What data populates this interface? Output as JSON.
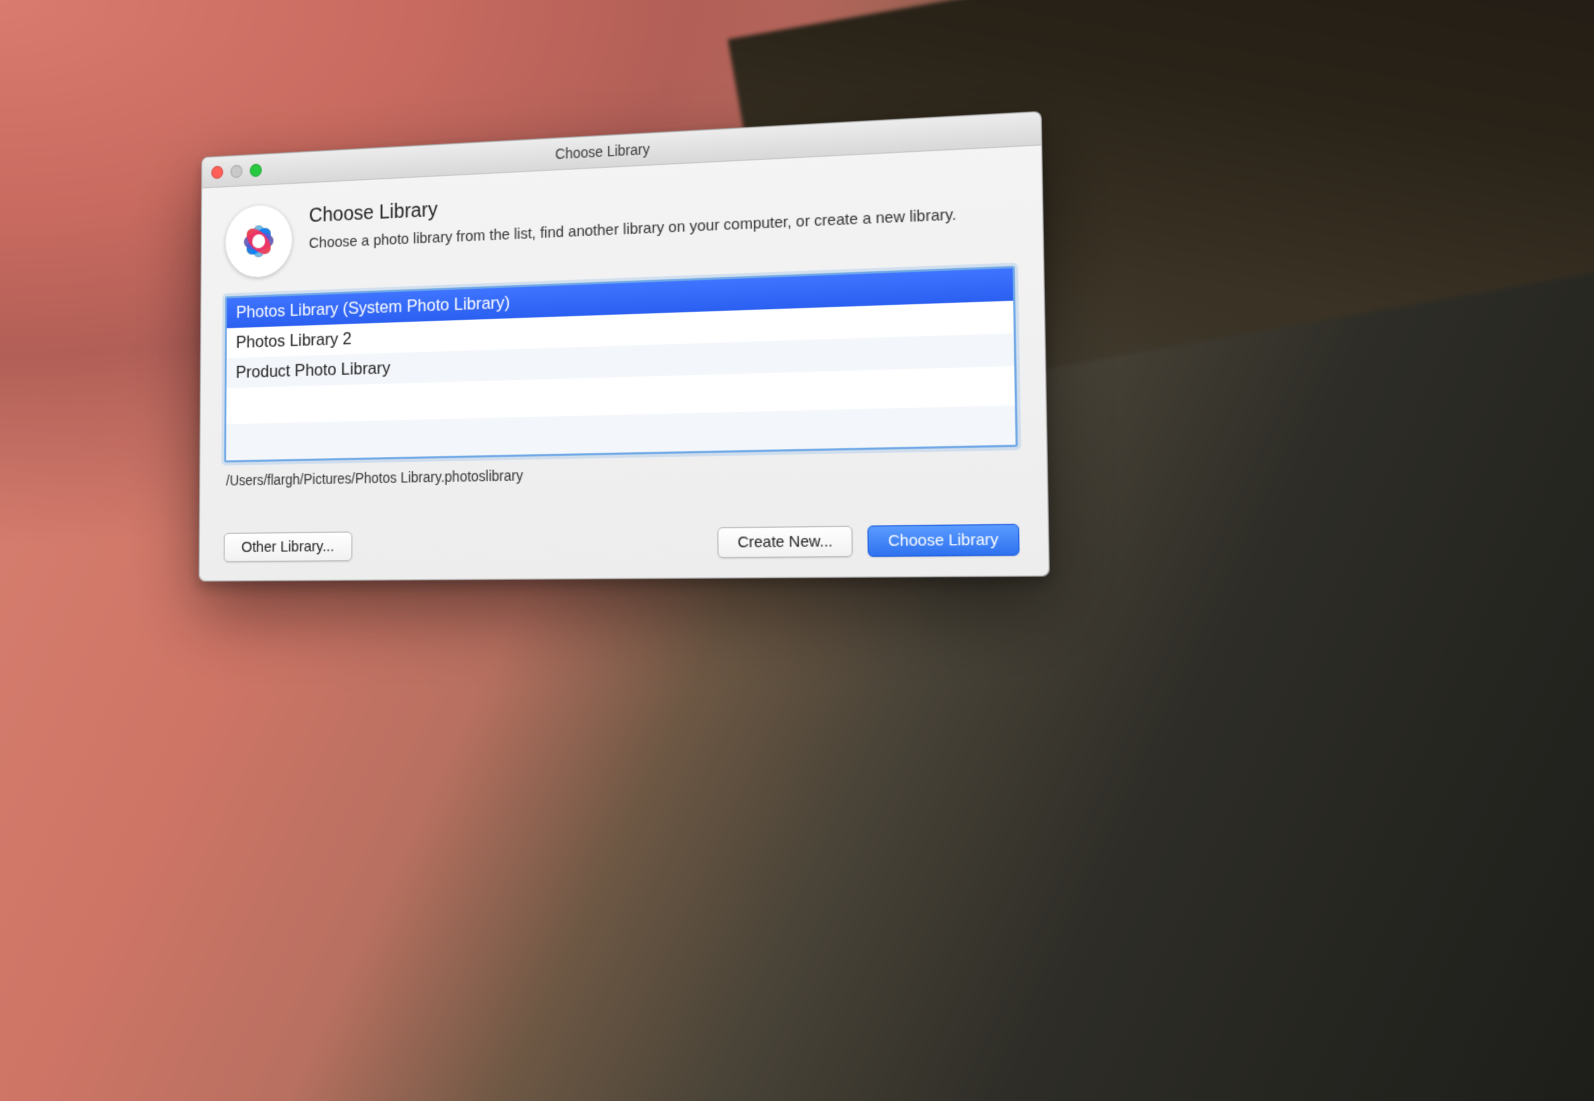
{
  "window": {
    "title": "Choose Library",
    "traffic_lights": [
      "close",
      "minimize",
      "zoom"
    ]
  },
  "dialog": {
    "icon_name": "photos-app-icon",
    "heading": "Choose Library",
    "description": "Choose a photo library from the list, find another library on your computer, or create a new library.",
    "libraries": [
      {
        "label": "Photos Library (System Photo Library)",
        "selected": true
      },
      {
        "label": "Photos Library 2",
        "selected": false
      },
      {
        "label": "Product Photo Library",
        "selected": false
      }
    ],
    "selected_path": "/Users/flargh/Pictures/Photos Library.photoslibrary"
  },
  "buttons": {
    "other_library": "Other Library...",
    "create_new": "Create New...",
    "choose": "Choose Library"
  },
  "colors": {
    "selection": "#2e72ef",
    "focus_ring": "#6fa8e6"
  }
}
